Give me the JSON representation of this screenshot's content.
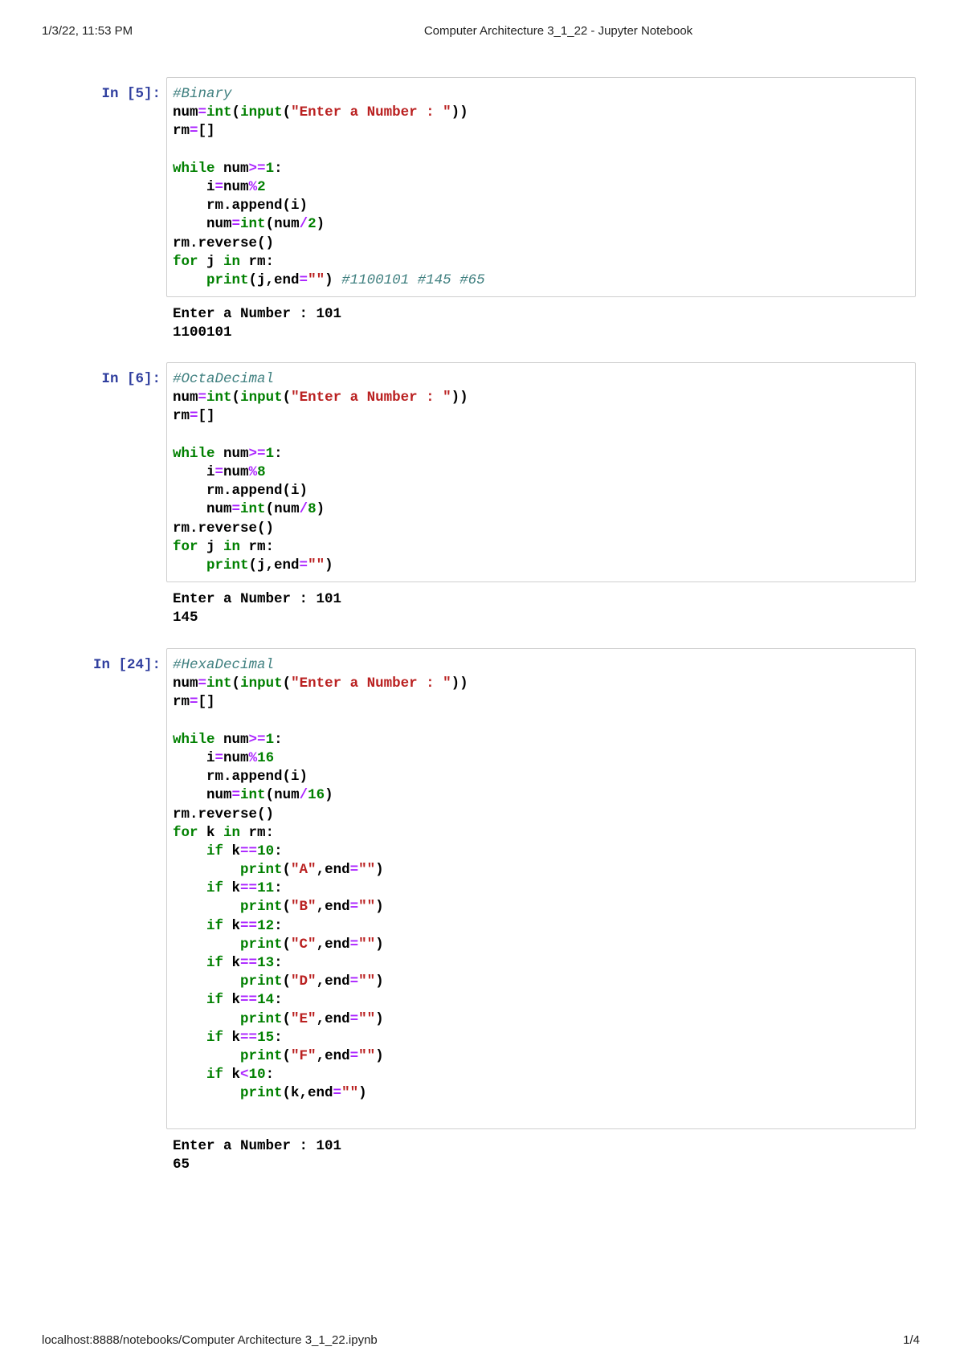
{
  "header": {
    "datetime": "1/3/22, 11:53 PM",
    "title": "Computer Architecture 3_1_22 - Jupyter Notebook"
  },
  "footer": {
    "url": "localhost:8888/notebooks/Computer Architecture 3_1_22.ipynb",
    "page": "1/4"
  },
  "cells": [
    {
      "prompt": "In [5]:",
      "lines": [
        [
          [
            "c",
            "#Binary"
          ]
        ],
        [
          [
            "n",
            "num"
          ],
          [
            "o",
            "="
          ],
          [
            "b",
            "int"
          ],
          [
            "p",
            "("
          ],
          [
            "b",
            "input"
          ],
          [
            "p",
            "("
          ],
          [
            "s",
            "\"Enter a Number : \""
          ],
          [
            "p",
            "))"
          ]
        ],
        [
          [
            "n",
            "rm"
          ],
          [
            "o",
            "="
          ],
          [
            "p",
            "[]"
          ]
        ],
        [],
        [
          [
            "k",
            "while"
          ],
          [
            "p",
            " "
          ],
          [
            "n",
            "num"
          ],
          [
            "o",
            ">="
          ],
          [
            "m",
            "1"
          ],
          [
            "p",
            ":"
          ]
        ],
        [
          [
            "p",
            "    "
          ],
          [
            "n",
            "i"
          ],
          [
            "o",
            "="
          ],
          [
            "n",
            "num"
          ],
          [
            "o",
            "%"
          ],
          [
            "m",
            "2"
          ]
        ],
        [
          [
            "p",
            "    "
          ],
          [
            "n",
            "rm.append(i)"
          ]
        ],
        [
          [
            "p",
            "    "
          ],
          [
            "n",
            "num"
          ],
          [
            "o",
            "="
          ],
          [
            "b",
            "int"
          ],
          [
            "p",
            "("
          ],
          [
            "n",
            "num"
          ],
          [
            "o",
            "/"
          ],
          [
            "m",
            "2"
          ],
          [
            "p",
            ")"
          ]
        ],
        [
          [
            "n",
            "rm.reverse()"
          ]
        ],
        [
          [
            "k",
            "for"
          ],
          [
            "p",
            " j "
          ],
          [
            "k",
            "in"
          ],
          [
            "p",
            " rm:"
          ]
        ],
        [
          [
            "p",
            "    "
          ],
          [
            "b",
            "print"
          ],
          [
            "p",
            "(j,end"
          ],
          [
            "o",
            "="
          ],
          [
            "s",
            "\"\""
          ],
          [
            "p",
            ") "
          ],
          [
            "c",
            "#1100101 #145 #65"
          ]
        ]
      ],
      "output": [
        "Enter a Number : 101",
        "1100101"
      ]
    },
    {
      "prompt": "In [6]:",
      "lines": [
        [
          [
            "c",
            "#OctaDecimal"
          ]
        ],
        [
          [
            "n",
            "num"
          ],
          [
            "o",
            "="
          ],
          [
            "b",
            "int"
          ],
          [
            "p",
            "("
          ],
          [
            "b",
            "input"
          ],
          [
            "p",
            "("
          ],
          [
            "s",
            "\"Enter a Number : \""
          ],
          [
            "p",
            "))"
          ]
        ],
        [
          [
            "n",
            "rm"
          ],
          [
            "o",
            "="
          ],
          [
            "p",
            "[]"
          ]
        ],
        [],
        [
          [
            "k",
            "while"
          ],
          [
            "p",
            " "
          ],
          [
            "n",
            "num"
          ],
          [
            "o",
            ">="
          ],
          [
            "m",
            "1"
          ],
          [
            "p",
            ":"
          ]
        ],
        [
          [
            "p",
            "    "
          ],
          [
            "n",
            "i"
          ],
          [
            "o",
            "="
          ],
          [
            "n",
            "num"
          ],
          [
            "o",
            "%"
          ],
          [
            "m",
            "8"
          ]
        ],
        [
          [
            "p",
            "    "
          ],
          [
            "n",
            "rm.append(i)"
          ]
        ],
        [
          [
            "p",
            "    "
          ],
          [
            "n",
            "num"
          ],
          [
            "o",
            "="
          ],
          [
            "b",
            "int"
          ],
          [
            "p",
            "("
          ],
          [
            "n",
            "num"
          ],
          [
            "o",
            "/"
          ],
          [
            "m",
            "8"
          ],
          [
            "p",
            ")"
          ]
        ],
        [
          [
            "n",
            "rm.reverse()"
          ]
        ],
        [
          [
            "k",
            "for"
          ],
          [
            "p",
            " j "
          ],
          [
            "k",
            "in"
          ],
          [
            "p",
            " rm:"
          ]
        ],
        [
          [
            "p",
            "    "
          ],
          [
            "b",
            "print"
          ],
          [
            "p",
            "(j,end"
          ],
          [
            "o",
            "="
          ],
          [
            "s",
            "\"\""
          ],
          [
            "p",
            ")"
          ]
        ]
      ],
      "output": [
        "Enter a Number : 101",
        "145"
      ]
    },
    {
      "prompt": "In [24]:",
      "lines": [
        [
          [
            "c",
            "#HexaDecimal"
          ]
        ],
        [
          [
            "n",
            "num"
          ],
          [
            "o",
            "="
          ],
          [
            "b",
            "int"
          ],
          [
            "p",
            "("
          ],
          [
            "b",
            "input"
          ],
          [
            "p",
            "("
          ],
          [
            "s",
            "\"Enter a Number : \""
          ],
          [
            "p",
            "))"
          ]
        ],
        [
          [
            "n",
            "rm"
          ],
          [
            "o",
            "="
          ],
          [
            "p",
            "[]"
          ]
        ],
        [],
        [
          [
            "k",
            "while"
          ],
          [
            "p",
            " "
          ],
          [
            "n",
            "num"
          ],
          [
            "o",
            ">="
          ],
          [
            "m",
            "1"
          ],
          [
            "p",
            ":"
          ]
        ],
        [
          [
            "p",
            "    "
          ],
          [
            "n",
            "i"
          ],
          [
            "o",
            "="
          ],
          [
            "n",
            "num"
          ],
          [
            "o",
            "%"
          ],
          [
            "m",
            "16"
          ]
        ],
        [
          [
            "p",
            "    "
          ],
          [
            "n",
            "rm.append(i)"
          ]
        ],
        [
          [
            "p",
            "    "
          ],
          [
            "n",
            "num"
          ],
          [
            "o",
            "="
          ],
          [
            "b",
            "int"
          ],
          [
            "p",
            "("
          ],
          [
            "n",
            "num"
          ],
          [
            "o",
            "/"
          ],
          [
            "m",
            "16"
          ],
          [
            "p",
            ")"
          ]
        ],
        [
          [
            "n",
            "rm.reverse()"
          ]
        ],
        [
          [
            "k",
            "for"
          ],
          [
            "p",
            " k "
          ],
          [
            "k",
            "in"
          ],
          [
            "p",
            " rm:"
          ]
        ],
        [
          [
            "p",
            "    "
          ],
          [
            "k",
            "if"
          ],
          [
            "p",
            " k"
          ],
          [
            "o",
            "=="
          ],
          [
            "m",
            "10"
          ],
          [
            "p",
            ":"
          ]
        ],
        [
          [
            "p",
            "        "
          ],
          [
            "b",
            "print"
          ],
          [
            "p",
            "("
          ],
          [
            "s",
            "\"A\""
          ],
          [
            "p",
            ",end"
          ],
          [
            "o",
            "="
          ],
          [
            "s",
            "\"\""
          ],
          [
            "p",
            ")"
          ]
        ],
        [
          [
            "p",
            "    "
          ],
          [
            "k",
            "if"
          ],
          [
            "p",
            " k"
          ],
          [
            "o",
            "=="
          ],
          [
            "m",
            "11"
          ],
          [
            "p",
            ":"
          ]
        ],
        [
          [
            "p",
            "        "
          ],
          [
            "b",
            "print"
          ],
          [
            "p",
            "("
          ],
          [
            "s",
            "\"B\""
          ],
          [
            "p",
            ",end"
          ],
          [
            "o",
            "="
          ],
          [
            "s",
            "\"\""
          ],
          [
            "p",
            ")"
          ]
        ],
        [
          [
            "p",
            "    "
          ],
          [
            "k",
            "if"
          ],
          [
            "p",
            " k"
          ],
          [
            "o",
            "=="
          ],
          [
            "m",
            "12"
          ],
          [
            "p",
            ":"
          ]
        ],
        [
          [
            "p",
            "        "
          ],
          [
            "b",
            "print"
          ],
          [
            "p",
            "("
          ],
          [
            "s",
            "\"C\""
          ],
          [
            "p",
            ",end"
          ],
          [
            "o",
            "="
          ],
          [
            "s",
            "\"\""
          ],
          [
            "p",
            ")"
          ]
        ],
        [
          [
            "p",
            "    "
          ],
          [
            "k",
            "if"
          ],
          [
            "p",
            " k"
          ],
          [
            "o",
            "=="
          ],
          [
            "m",
            "13"
          ],
          [
            "p",
            ":"
          ]
        ],
        [
          [
            "p",
            "        "
          ],
          [
            "b",
            "print"
          ],
          [
            "p",
            "("
          ],
          [
            "s",
            "\"D\""
          ],
          [
            "p",
            ",end"
          ],
          [
            "o",
            "="
          ],
          [
            "s",
            "\"\""
          ],
          [
            "p",
            ")"
          ]
        ],
        [
          [
            "p",
            "    "
          ],
          [
            "k",
            "if"
          ],
          [
            "p",
            " k"
          ],
          [
            "o",
            "=="
          ],
          [
            "m",
            "14"
          ],
          [
            "p",
            ":"
          ]
        ],
        [
          [
            "p",
            "        "
          ],
          [
            "b",
            "print"
          ],
          [
            "p",
            "("
          ],
          [
            "s",
            "\"E\""
          ],
          [
            "p",
            ",end"
          ],
          [
            "o",
            "="
          ],
          [
            "s",
            "\"\""
          ],
          [
            "p",
            ")"
          ]
        ],
        [
          [
            "p",
            "    "
          ],
          [
            "k",
            "if"
          ],
          [
            "p",
            " k"
          ],
          [
            "o",
            "=="
          ],
          [
            "m",
            "15"
          ],
          [
            "p",
            ":"
          ]
        ],
        [
          [
            "p",
            "        "
          ],
          [
            "b",
            "print"
          ],
          [
            "p",
            "("
          ],
          [
            "s",
            "\"F\""
          ],
          [
            "p",
            ",end"
          ],
          [
            "o",
            "="
          ],
          [
            "s",
            "\"\""
          ],
          [
            "p",
            ")"
          ]
        ],
        [
          [
            "p",
            "    "
          ],
          [
            "k",
            "if"
          ],
          [
            "p",
            " k"
          ],
          [
            "o",
            "<"
          ],
          [
            "m",
            "10"
          ],
          [
            "p",
            ":"
          ]
        ],
        [
          [
            "p",
            "        "
          ],
          [
            "b",
            "print"
          ],
          [
            "p",
            "(k,end"
          ],
          [
            "o",
            "="
          ],
          [
            "s",
            "\"\""
          ],
          [
            "p",
            ")"
          ]
        ],
        []
      ],
      "output": [
        "Enter a Number : 101",
        "65"
      ]
    }
  ]
}
